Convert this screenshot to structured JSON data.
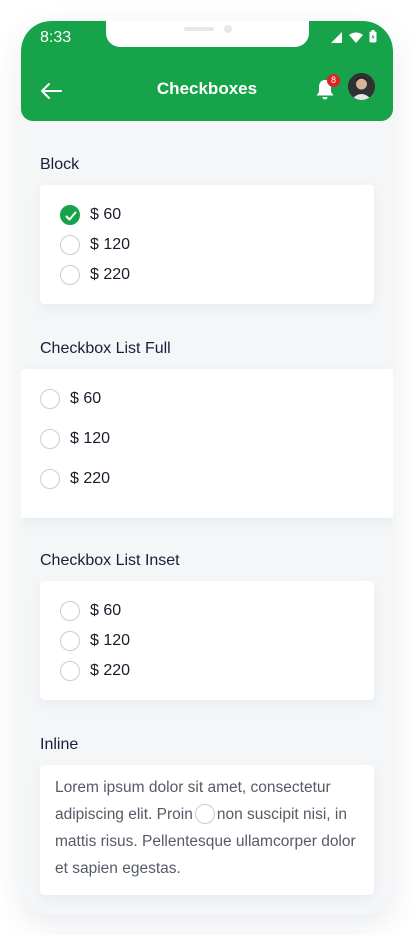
{
  "status_bar": {
    "time": "8:33"
  },
  "header": {
    "title": "Checkboxes",
    "notification_count": "8"
  },
  "sections": {
    "block": {
      "title": "Block",
      "options": [
        {
          "label": "$ 60",
          "checked": true
        },
        {
          "label": "$ 120",
          "checked": false
        },
        {
          "label": "$ 220",
          "checked": false
        }
      ]
    },
    "list_full": {
      "title": "Checkbox List Full",
      "options": [
        {
          "label": "$ 60",
          "checked": false
        },
        {
          "label": "$ 120",
          "checked": false
        },
        {
          "label": "$ 220",
          "checked": false
        }
      ]
    },
    "list_inset": {
      "title": "Checkbox List Inset",
      "options": [
        {
          "label": "$ 60",
          "checked": false
        },
        {
          "label": "$ 120",
          "checked": false
        },
        {
          "label": "$ 220",
          "checked": false
        }
      ]
    },
    "inline": {
      "title": "Inline",
      "text_before": "Lorem ipsum dolor sit amet, consectetur adipiscing elit. Proin",
      "text_after": "non suscipit nisi, in mattis risus. Pellentesque ullamcorper dolor et sapien egestas."
    }
  },
  "colors": {
    "accent": "#17a34a",
    "badge": "#e02424",
    "background": "#f4f6f8"
  }
}
